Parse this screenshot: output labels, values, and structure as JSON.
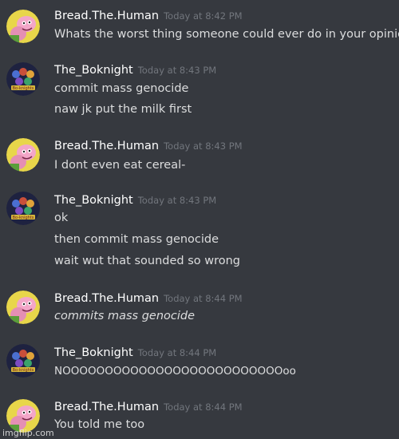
{
  "users": {
    "bread": "Bread.The.Human",
    "boknight": "The_Boknight"
  },
  "messages": [
    {
      "user": "Bread.The.Human",
      "time": "Today at 8:42 PM",
      "lines": [
        "Whats the worst thing someone could ever do in your opinion"
      ]
    },
    {
      "user": "The_Boknight",
      "time": "Today at 8:43 PM",
      "lines": [
        "commit mass genocide",
        "naw jk put the milk first"
      ]
    },
    {
      "user": "Bread.The.Human",
      "time": "Today at 8:43 PM",
      "lines": [
        "I dont even eat cereal-"
      ]
    },
    {
      "user": "The_Boknight",
      "time": "Today at 8:43 PM",
      "lines": [
        "ok",
        "then commit mass genocide",
        "wait wut that sounded so wrong"
      ]
    },
    {
      "user": "Bread.The.Human",
      "time": "Today at 8:44 PM",
      "lines": [
        "commits mass genocide"
      ],
      "italic": true
    },
    {
      "user": "The_Boknight",
      "time": "Today at 8:44 PM",
      "lines": [
        "NOOOOOOOOOOOOOOOOOOOOOOOOOOoo"
      ]
    },
    {
      "user": "Bread.The.Human",
      "time": "Today at 8:44 PM",
      "lines": [
        "You told me too"
      ]
    }
  ],
  "watermark": "imgflip.com",
  "colors": {
    "background": "#36393f",
    "username": "#ffffff",
    "timestamp": "#72767d",
    "text": "#dcddde"
  },
  "avatars": {
    "Bread.The.Human": "pink-cartoon-character-avatar",
    "The_Boknight": "boknight-group-avatar"
  }
}
